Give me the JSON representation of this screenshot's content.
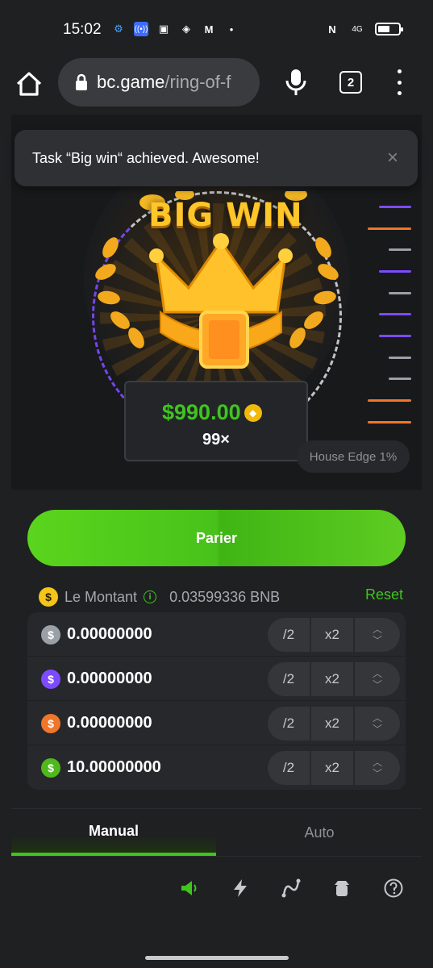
{
  "status_bar": {
    "time": "15:02",
    "network": "4G"
  },
  "browser": {
    "url_host": "bc.game",
    "url_path": "/ring-of-f",
    "tab_count": "2"
  },
  "toast": {
    "message": "Task “Big win“ achieved. Awesome!",
    "close": "×"
  },
  "game": {
    "big_win_label": "BIG WIN",
    "win_amount": "$990.00",
    "multiplier": "99×",
    "house_edge": "House Edge 1%",
    "coin_symbol": "◆"
  },
  "controls": {
    "bet_button": "Parier",
    "amount_label": "Le Montant",
    "amount_value": "0.03599336 BNB",
    "reset": "Reset",
    "rows": [
      {
        "value": "0.00000000",
        "color": "#9aa0a8",
        "half": "/2",
        "double": "x2"
      },
      {
        "value": "0.00000000",
        "color": "#7d4bff",
        "half": "/2",
        "double": "x2"
      },
      {
        "value": "0.00000000",
        "color": "#f0762a",
        "half": "/2",
        "double": "x2"
      },
      {
        "value": "10.00000000",
        "color": "#4fb81c",
        "half": "/2",
        "double": "x2"
      }
    ],
    "tab_manual": "Manual",
    "tab_auto": "Auto"
  }
}
